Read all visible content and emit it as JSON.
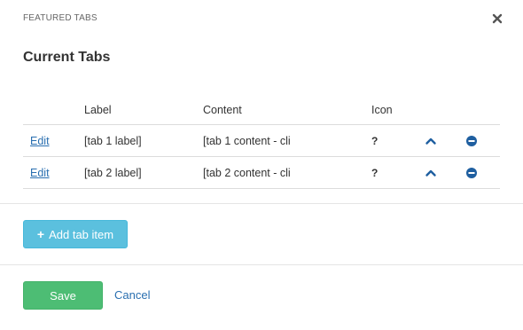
{
  "modal": {
    "title": "FEATURED TABS",
    "close_icon": "close-icon"
  },
  "section": {
    "title": "Current Tabs"
  },
  "table": {
    "headers": {
      "label": "Label",
      "content": "Content",
      "icon": "Icon"
    },
    "rows": [
      {
        "edit": "Edit",
        "label": "[tab 1 label]",
        "content": "[tab 1 content - cli",
        "icon": "?",
        "up_icon": "chevron-up-icon",
        "remove_icon": "minus-circle-icon"
      },
      {
        "edit": "Edit",
        "label": "[tab 2 label]",
        "content": "[tab 2 content - cli",
        "icon": "?",
        "up_icon": "chevron-up-icon",
        "remove_icon": "minus-circle-icon"
      }
    ]
  },
  "actions": {
    "add_tab_label": "Add tab item",
    "save_label": "Save",
    "cancel_label": "Cancel"
  },
  "colors": {
    "link": "#2a6fb0",
    "add_button": "#5bc0de",
    "save_button": "#4dbd74",
    "icon_dark": "#1f5fa0"
  }
}
